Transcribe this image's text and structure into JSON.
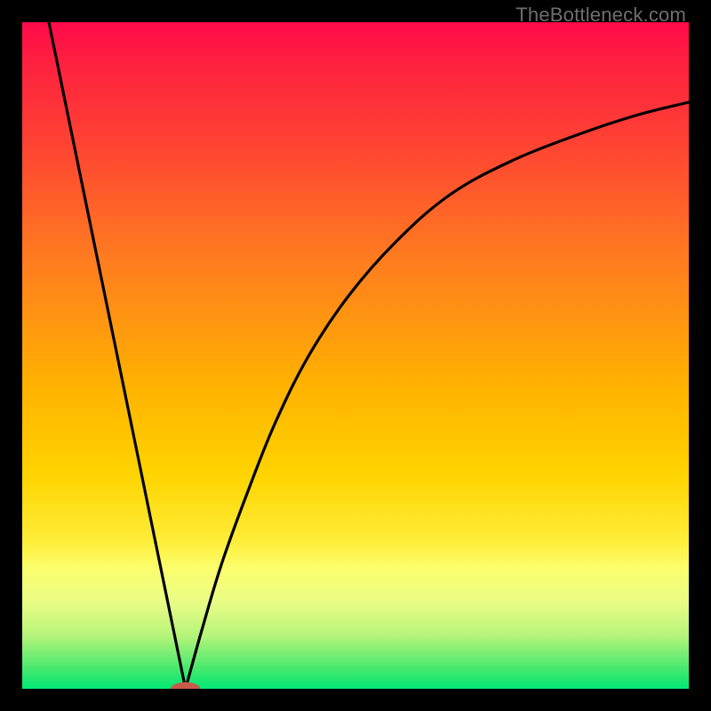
{
  "attribution": "TheBottleneck.com",
  "chart_data": {
    "type": "line",
    "title": "",
    "xlabel": "",
    "ylabel": "",
    "xlim": [
      0,
      100
    ],
    "ylim": [
      0,
      100
    ],
    "series": [
      {
        "name": "left-branch",
        "x": [
          4,
          24.5
        ],
        "y": [
          100,
          0
        ]
      },
      {
        "name": "right-branch",
        "x": [
          24.5,
          27,
          30,
          34,
          38,
          43,
          49,
          56,
          64,
          73,
          83,
          92,
          100
        ],
        "y": [
          0,
          9,
          19,
          30,
          40,
          50,
          59,
          67,
          74,
          79,
          83,
          86,
          88
        ]
      }
    ],
    "marker": {
      "x": 24.5,
      "y": 0,
      "rx": 2.2,
      "ry": 1.0,
      "color": "#c85a4a"
    },
    "background_gradient": {
      "top": "#ff0a4a",
      "mid": "#ffd400",
      "bottom": "#00e873"
    }
  }
}
